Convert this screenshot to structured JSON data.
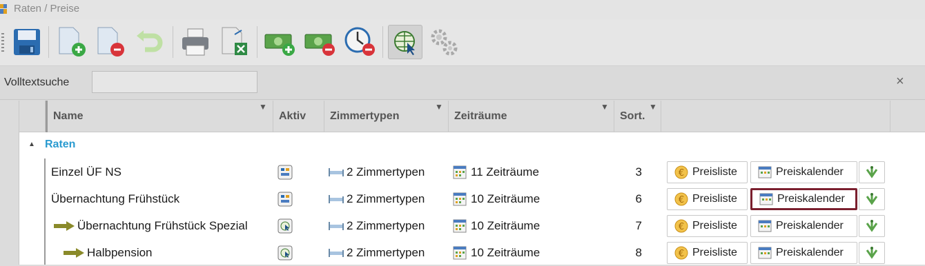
{
  "window": {
    "title": "Raten / Preise"
  },
  "toolbar": {
    "buttons": [
      {
        "icon": "save-icon"
      },
      {
        "icon": "new-document-icon"
      },
      {
        "icon": "delete-document-icon"
      },
      {
        "icon": "undo-icon"
      },
      {
        "icon": "print-icon"
      },
      {
        "icon": "export-excel-icon"
      },
      {
        "icon": "add-money-icon"
      },
      {
        "icon": "remove-money-icon"
      },
      {
        "icon": "remove-time-icon"
      },
      {
        "icon": "web-globe-icon"
      },
      {
        "icon": "settings-gears-icon"
      }
    ]
  },
  "search": {
    "label": "Volltextsuche",
    "value": "",
    "close": "×"
  },
  "columns": {
    "name": "Name",
    "aktiv": "Aktiv",
    "zimmertypen": "Zimmertypen",
    "zeitraeume": "Zeiträume",
    "sort": "Sort."
  },
  "group": {
    "label": "Raten"
  },
  "rows": [
    {
      "name": "Einzel ÜF NS",
      "indent": 0,
      "zimmertypen": "2 Zimmertypen",
      "zeitraeume": "11 Zeiträume",
      "sort": "3",
      "aktiv_icon": "rate-active-icon",
      "preisliste": "Preisliste",
      "preiskalender": "Preiskalender"
    },
    {
      "name": "Übernachtung Frühstück",
      "indent": 0,
      "zimmertypen": "2 Zimmertypen",
      "zeitraeume": "10 Zeiträume",
      "sort": "6",
      "aktiv_icon": "rate-active-icon",
      "preisliste": "Preisliste",
      "preiskalender": "Preiskalender"
    },
    {
      "name": "Übernachtung Frühstück Spezial",
      "indent": 1,
      "zimmertypen": "2 Zimmertypen",
      "zeitraeume": "10 Zeiträume",
      "sort": "7",
      "aktiv_icon": "rate-derived-icon",
      "preisliste": "Preisliste",
      "preiskalender": "Preiskalender"
    },
    {
      "name": "Halbpension",
      "indent": 2,
      "zimmertypen": "2 Zimmertypen",
      "zeitraeume": "10 Zeiträume",
      "sort": "8",
      "aktiv_icon": "rate-derived-icon",
      "preisliste": "Preisliste",
      "preiskalender": "Preiskalender"
    }
  ],
  "colors": {
    "group_label": "#2a9bd0",
    "selected_border": "#7a1f2e",
    "arrow": "#8a8a2a"
  }
}
